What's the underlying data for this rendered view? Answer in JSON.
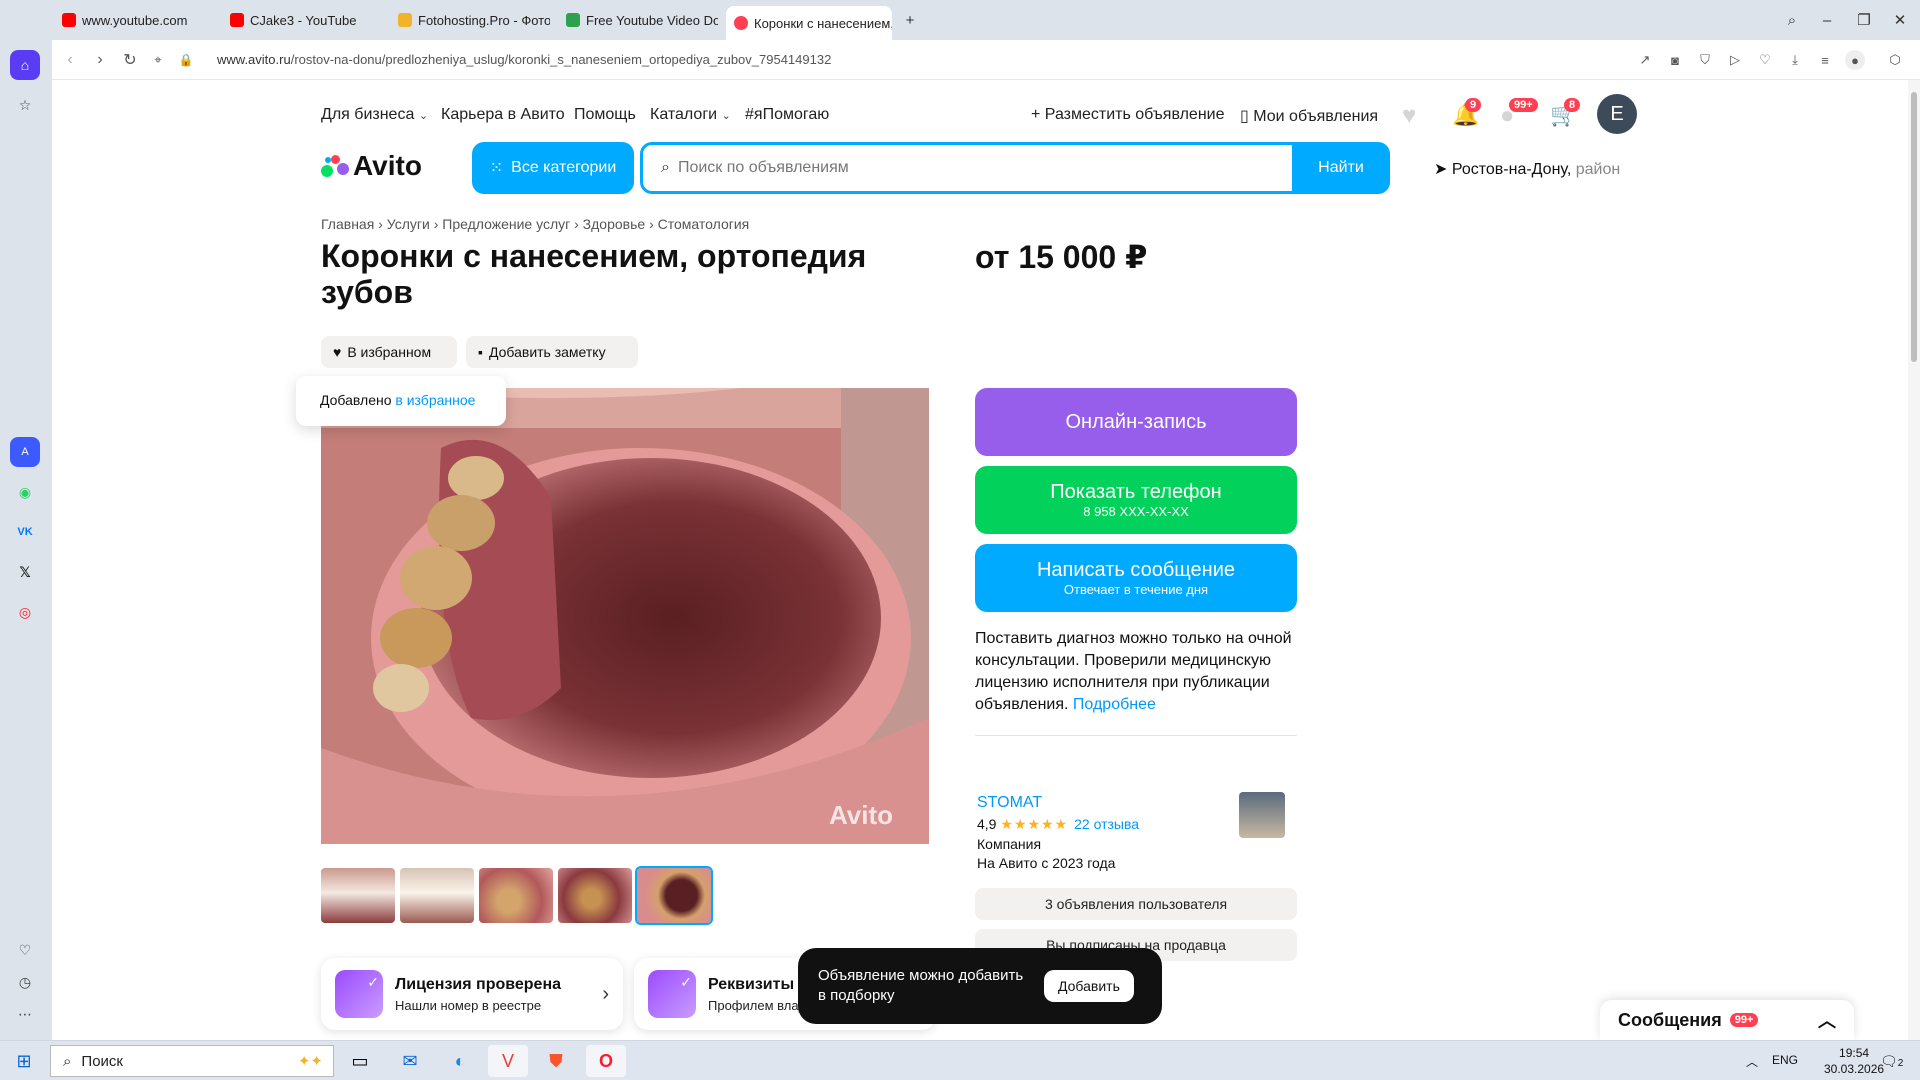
{
  "browser": {
    "tabs": [
      {
        "label": "www.youtube.com",
        "color": "#ff0000"
      },
      {
        "label": "CJake3 - YouTube",
        "color": "#ff0000"
      },
      {
        "label": "Fotohosting.Pro - Фотохо",
        "color": "#f0b429"
      },
      {
        "label": "Free Youtube Video Down",
        "color": "#2ca24c"
      },
      {
        "label": "Коронки с нанесением, с",
        "color": "#ff4053"
      }
    ],
    "url_host": "www.avito.ru",
    "url_path": "/rostov-na-donu/predlozheniya_uslug/koronki_s_naneseniem_ortopediya_zubov_7954149132"
  },
  "header": {
    "nav": [
      "Для бизнеса",
      "Карьера в Авито",
      "Помощь",
      "Каталоги",
      "#яПомогаю"
    ],
    "post_ad": "Разместить объявление",
    "my_ads": "Мои объявления",
    "notif_count": "9",
    "msg_count": "99+",
    "cart_count": "8",
    "avatar_letter": "E",
    "logo": "Avito",
    "all_categories": "Все категории",
    "search_placeholder": "Поиск по объявлениям",
    "find": "Найти",
    "location_city": "Ростов-на-Дону,",
    "location_area": "район"
  },
  "breadcrumb": [
    "Главная",
    "Услуги",
    "Предложение услуг",
    "Здоровье",
    "Стоматология"
  ],
  "listing": {
    "title": "Коронки с нанесением, ортопедия зубов",
    "price": "от 15 000 ₽",
    "favorite_label": "В избранном",
    "note_label": "Добавить заметку",
    "tooltip_text": "Добавлено",
    "tooltip_link": "в избранное",
    "watermark": "Avito"
  },
  "actions": {
    "online_booking": "Онлайн-запись",
    "show_phone": "Показать телефон",
    "phone_masked": "8 958 XXX-XX-XX",
    "write_message": "Написать сообщение",
    "reply_time": "Отвечает в течение дня",
    "notice": "Поставить диагноз можно только на очной консультации. Проверили медицинскую лицензию исполнителя при публикации объявления.",
    "notice_link": "Подробнее"
  },
  "seller": {
    "name": "STOMAT",
    "rating": "4,9",
    "stars": "★★★★★",
    "reviews": "22 отзыва",
    "type": "Компания",
    "since": "На Авито с 2023 года",
    "ads_count": "3 объявления пользователя",
    "subscribed": "Вы подписаны на продавца"
  },
  "cards": [
    {
      "title": "Лицензия проверена",
      "sub": "Нашли номер в реестре"
    },
    {
      "title": "Реквизиты п",
      "sub": "Профилем влад"
    }
  ],
  "toast": {
    "text": "Объявление можно добавить в подборку",
    "button": "Добавить"
  },
  "messages_widget": {
    "label": "Сообщения",
    "badge": "99+"
  },
  "taskbar": {
    "search": "Поиск",
    "lang": "ENG",
    "time": "19:54",
    "date": "30.03.2026",
    "notif": "2"
  }
}
